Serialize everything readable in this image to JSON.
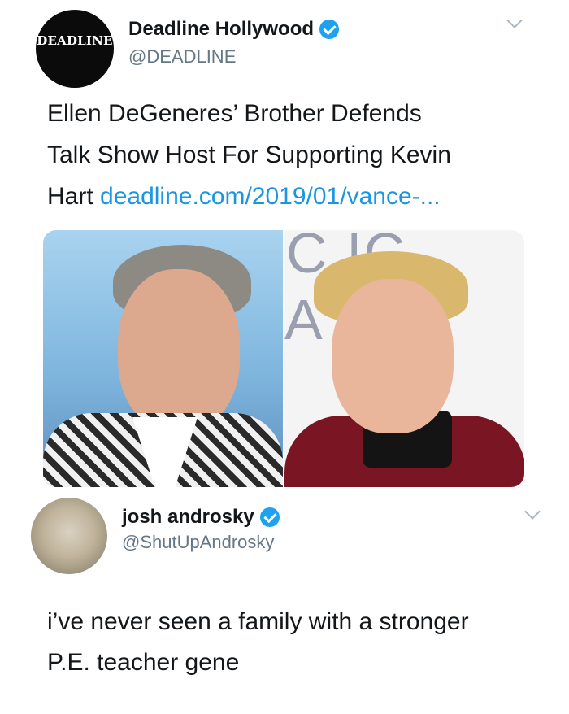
{
  "tweet": {
    "avatar_text": "DEADLINE",
    "name": "Deadline Hollywood",
    "handle": "@DEADLINE",
    "text_lines": [
      "Ellen DeGeneres’ Brother Defends",
      "Talk Show Host For Supporting Kevin",
      "Hart "
    ],
    "link": "deadline.com/2019/01/vance-...",
    "media_bg_text": [
      "C  IC",
      "A      RD"
    ]
  },
  "reply": {
    "name": "josh androsky",
    "handle": "@ShutUpAndrosky",
    "text_lines": [
      "i’ve never seen a family with a stronger",
      "P.E. teacher gene"
    ]
  },
  "icons": {
    "verified": "verified-badge-icon",
    "menu": "chevron-down-icon"
  },
  "colors": {
    "link": "#1b95e0",
    "verified": "#1da1f2",
    "handle": "#657786"
  }
}
